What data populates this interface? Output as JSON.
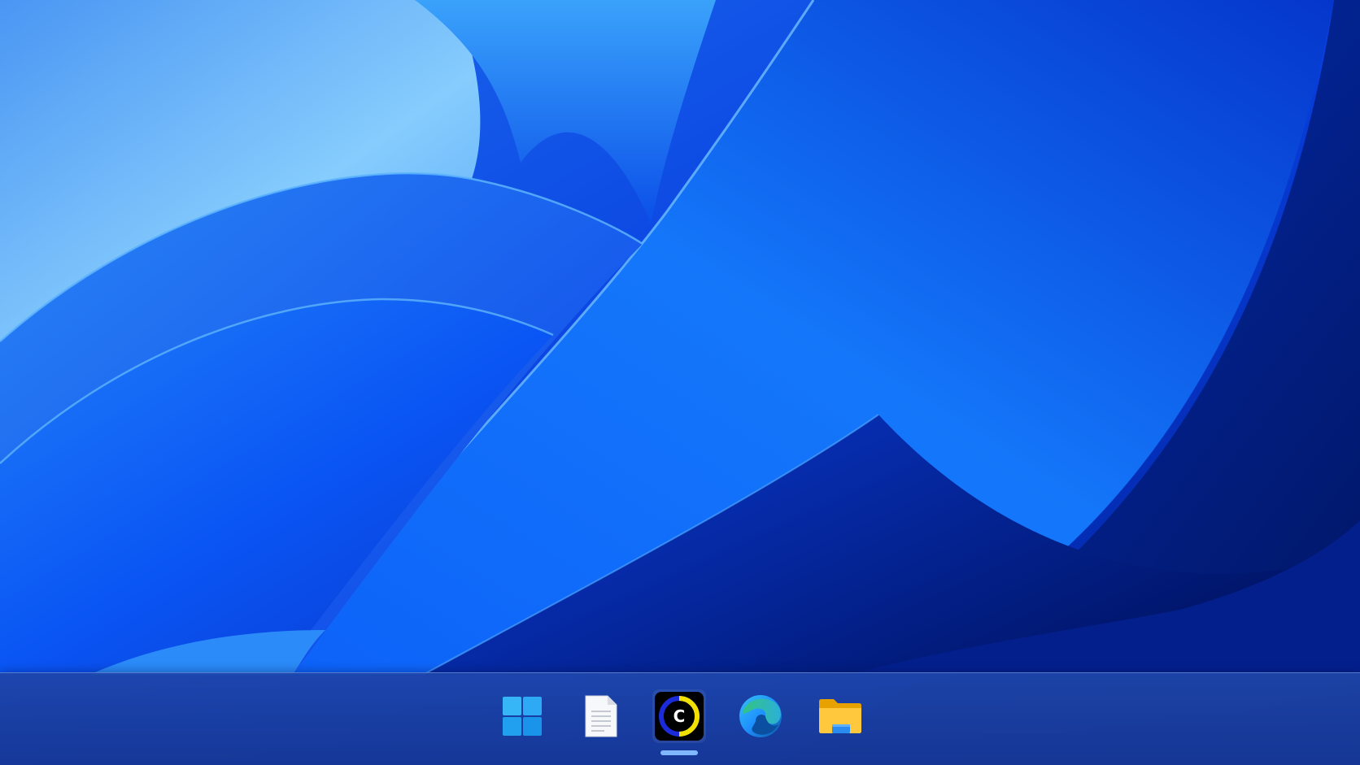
{
  "desktop": {
    "wallpaper": "windows-11-bloom",
    "colors": {
      "deep_blue": "#0021a8",
      "mid_blue": "#0a55f0",
      "light_blue": "#7cc4fb",
      "navy": "#001a7a"
    }
  },
  "taskbar": {
    "background": "#1c44a8",
    "items": [
      {
        "id": "start",
        "icon": "windows-start-icon",
        "running": false,
        "colors": [
          "#2ab0f5",
          "#1a8fe8"
        ]
      },
      {
        "id": "notepad",
        "icon": "document-icon",
        "running": false,
        "colors": [
          "#ffffff",
          "#d4d8de"
        ]
      },
      {
        "id": "app-c",
        "icon": "letter-c-app-icon",
        "running": true,
        "colors": [
          "#000000",
          "#f2e100",
          "#1b2bd9"
        ],
        "glyph": "C"
      },
      {
        "id": "edge",
        "icon": "edge-browser-icon",
        "running": false,
        "colors": [
          "#0c59a4",
          "#33c481",
          "#1e90ff"
        ]
      },
      {
        "id": "file-explorer",
        "icon": "folder-icon",
        "running": false,
        "colors": [
          "#ffc83d",
          "#e8a200",
          "#2a8cf0"
        ]
      }
    ],
    "indicator_color": "#7fb8ff"
  }
}
